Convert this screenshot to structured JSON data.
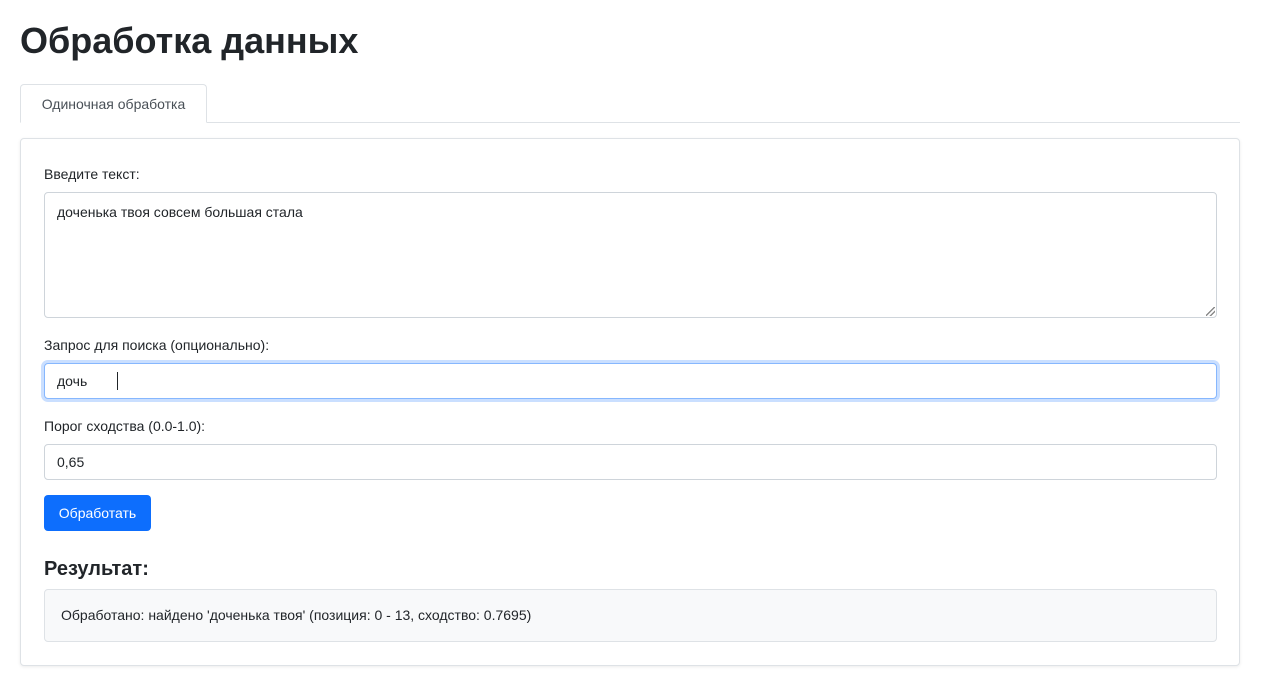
{
  "header": {
    "title": "Обработка данных"
  },
  "tabs": [
    {
      "label": "Одиночная обработка",
      "active": true
    }
  ],
  "form": {
    "text_label": "Введите текст:",
    "text_value": "доченька твоя совсем большая стала",
    "query_label": "Запрос для поиска (опционально):",
    "query_value": "дочь",
    "threshold_label": "Порог сходства (0.0-1.0):",
    "threshold_value": "0,65",
    "submit_label": "Обработать"
  },
  "result": {
    "title": "Результат:",
    "text": "Обработано: найдено 'доченька твоя' (позиция: 0 - 13, сходство: 0.7695)"
  },
  "colors": {
    "primary": "#0d6efd",
    "focus_border": "#86b7fe",
    "result_bg": "#f8f9fa",
    "border": "#dee2e6"
  }
}
